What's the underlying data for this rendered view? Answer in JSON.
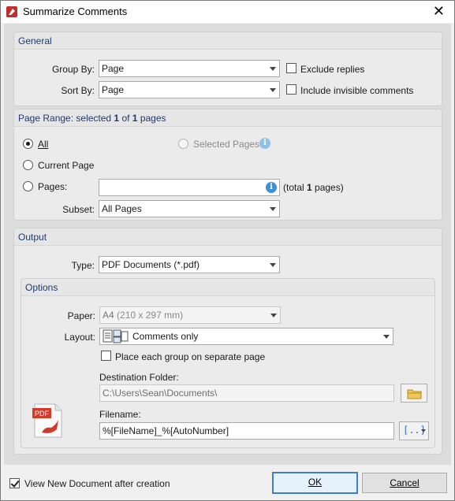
{
  "window": {
    "title": "Summarize Comments"
  },
  "general": {
    "section_title": "General",
    "group_by_label": "Group By:",
    "group_by_value": "Page",
    "sort_by_label": "Sort By:",
    "sort_by_value": "Page",
    "exclude_replies_label": "Exclude replies",
    "exclude_replies_checked": false,
    "include_invisible_label": "Include invisible comments",
    "include_invisible_checked": false
  },
  "page_range": {
    "title_prefix": "Page Range: selected ",
    "selected": "1",
    "of": " of ",
    "total": "1",
    "pages_word": " pages",
    "all_label": "All",
    "current_page_label": "Current Page",
    "pages_label": "Pages:",
    "selected_pages_label": "Selected Pages",
    "pages_input_value": "",
    "total_prefix": "(total ",
    "total_count": "1",
    "total_suffix": " pages)",
    "subset_label": "Subset:",
    "subset_value": "All Pages",
    "selected_option": "All"
  },
  "output": {
    "section_title": "Output",
    "type_label": "Type:",
    "type_value": "PDF Documents (*.pdf)",
    "options": {
      "section_title": "Options",
      "paper_label": "Paper:",
      "paper_value": "A4",
      "paper_dims": "(210 x 297 mm)",
      "layout_label": "Layout:",
      "layout_value": "Comments only",
      "separate_page_label": "Place each group on separate page",
      "separate_page_checked": false,
      "destination_label": "Destination Folder:",
      "destination_value": "C:\\Users\\Sean\\Documents\\",
      "filename_label": "Filename:",
      "filename_value": "%[FileName]_%[AutoNumber]",
      "pdf_badge": "PDF"
    }
  },
  "footer": {
    "view_new_label": "View New Document after creation",
    "view_new_checked": true,
    "ok_label": "OK",
    "cancel_label": "Cancel"
  },
  "colors": {
    "accent": "#3c7fd1",
    "info": "#3c8fd9",
    "pdf_red": "#d23a2a",
    "section_title": "#1f3a6e"
  }
}
